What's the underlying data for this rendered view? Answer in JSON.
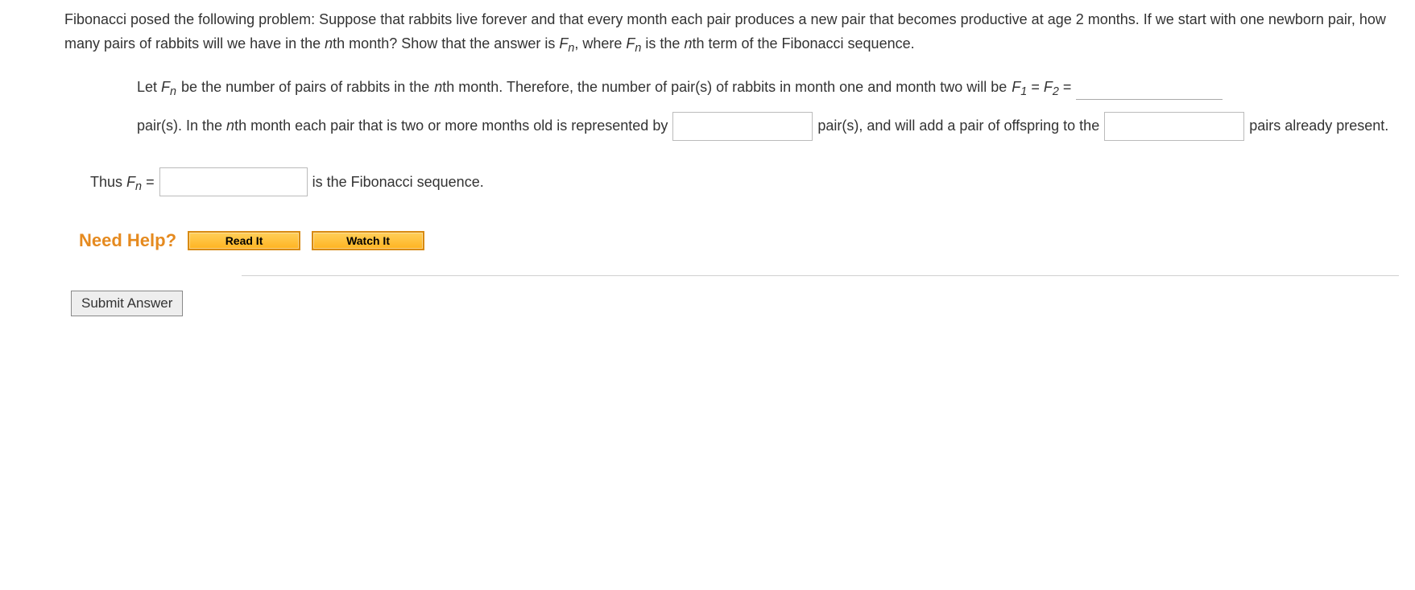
{
  "problem": {
    "intro": "Fibonacci posed the following problem: Suppose that rabbits live forever and that every month each pair produces a new pair that becomes productive at age 2 months. If we start with one newborn pair, how many pairs of rabbits will we have in the ",
    "nth1": "n",
    "nth1_suffix": "th month? Show that the answer is ",
    "fn": "F",
    "fn_sub": "n",
    "comma_where": ",  where ",
    "fn2": "F",
    "fn2_sub": "n",
    "is_the": " is the ",
    "nth2": "n",
    "nth2_suffix": "th term of the Fibonacci sequence."
  },
  "solution": {
    "line1_a": "Let ",
    "line1_fn": "F",
    "line1_fn_sub": "n",
    "line1_b": " be the number of pairs of rabbits in the ",
    "line1_n": "n",
    "line1_c": "th month. Therefore, the number of pair(s) of rabbits in month one and month two will be ",
    "f1": "F",
    "f1_sub": "1",
    "eq": " = ",
    "f2": "F",
    "f2_sub": "2",
    "eq2": " = ",
    "line1_d": "pair(s). In the ",
    "line1_n2": "n",
    "line1_e": "th month each pair that is two or more months old is represented by",
    "line2_a": "pair(s), and will add a pair of offspring to the",
    "line2_b": "pairs already present.",
    "thus_a": "Thus ",
    "thus_fn": "F",
    "thus_fn_sub": "n",
    "thus_eq": " = ",
    "thus_b": "is the Fibonacci sequence."
  },
  "help": {
    "label": "Need Help?",
    "read": "Read It",
    "watch": "Watch It"
  },
  "submit": "Submit Answer"
}
